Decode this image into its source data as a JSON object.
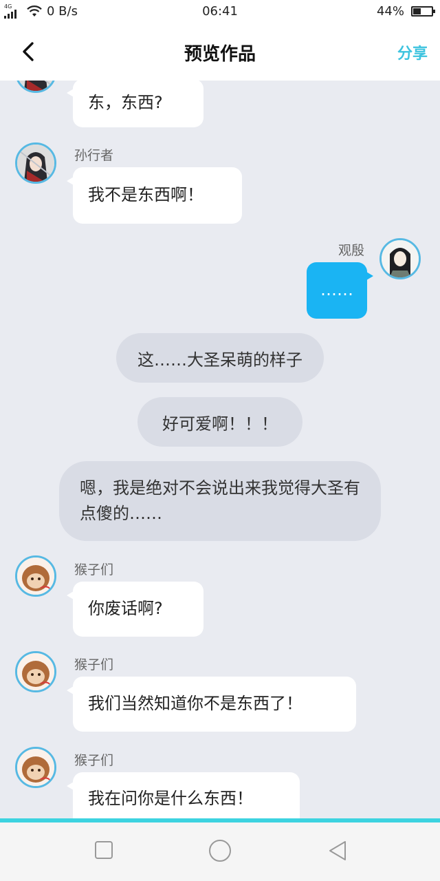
{
  "status_bar": {
    "network": "4G",
    "speed": "0 B/s",
    "time": "06:41",
    "battery": "44%",
    "battery_level": 0.44
  },
  "header": {
    "title": "预览作品",
    "share_label": "分享"
  },
  "messages": [
    {
      "type": "left",
      "sender": "",
      "text": "东，东西?",
      "avatar": "warrior-avatar"
    },
    {
      "type": "left",
      "sender": "孙行者",
      "text": "我不是东西啊！",
      "avatar": "warrior-avatar"
    },
    {
      "type": "right",
      "sender": "观殷",
      "text": "……",
      "avatar": "scholar-avatar"
    },
    {
      "type": "narration",
      "text": "这……大圣呆萌的样子"
    },
    {
      "type": "narration",
      "text": "好可爱啊！！！"
    },
    {
      "type": "narration",
      "text": "嗯，我是绝对不会说出来我觉得大圣有点傻的……"
    },
    {
      "type": "left",
      "sender": "猴子们",
      "text": "你废话啊?",
      "avatar": "monkey-avatar"
    },
    {
      "type": "left",
      "sender": "猴子们",
      "text": "我们当然知道你不是东西了！",
      "avatar": "monkey-avatar"
    },
    {
      "type": "left",
      "sender": "猴子们",
      "text": "我在问你是什么东西！",
      "avatar": "monkey-avatar"
    }
  ],
  "colors": {
    "accent": "#3dc3df",
    "my_bubble": "#1ab4f3",
    "avatar_ring": "#57b9e3"
  },
  "icons": {
    "back": "chevron-left-icon",
    "recent": "square-icon",
    "home": "circle-icon",
    "nav_back": "triangle-left-icon"
  }
}
